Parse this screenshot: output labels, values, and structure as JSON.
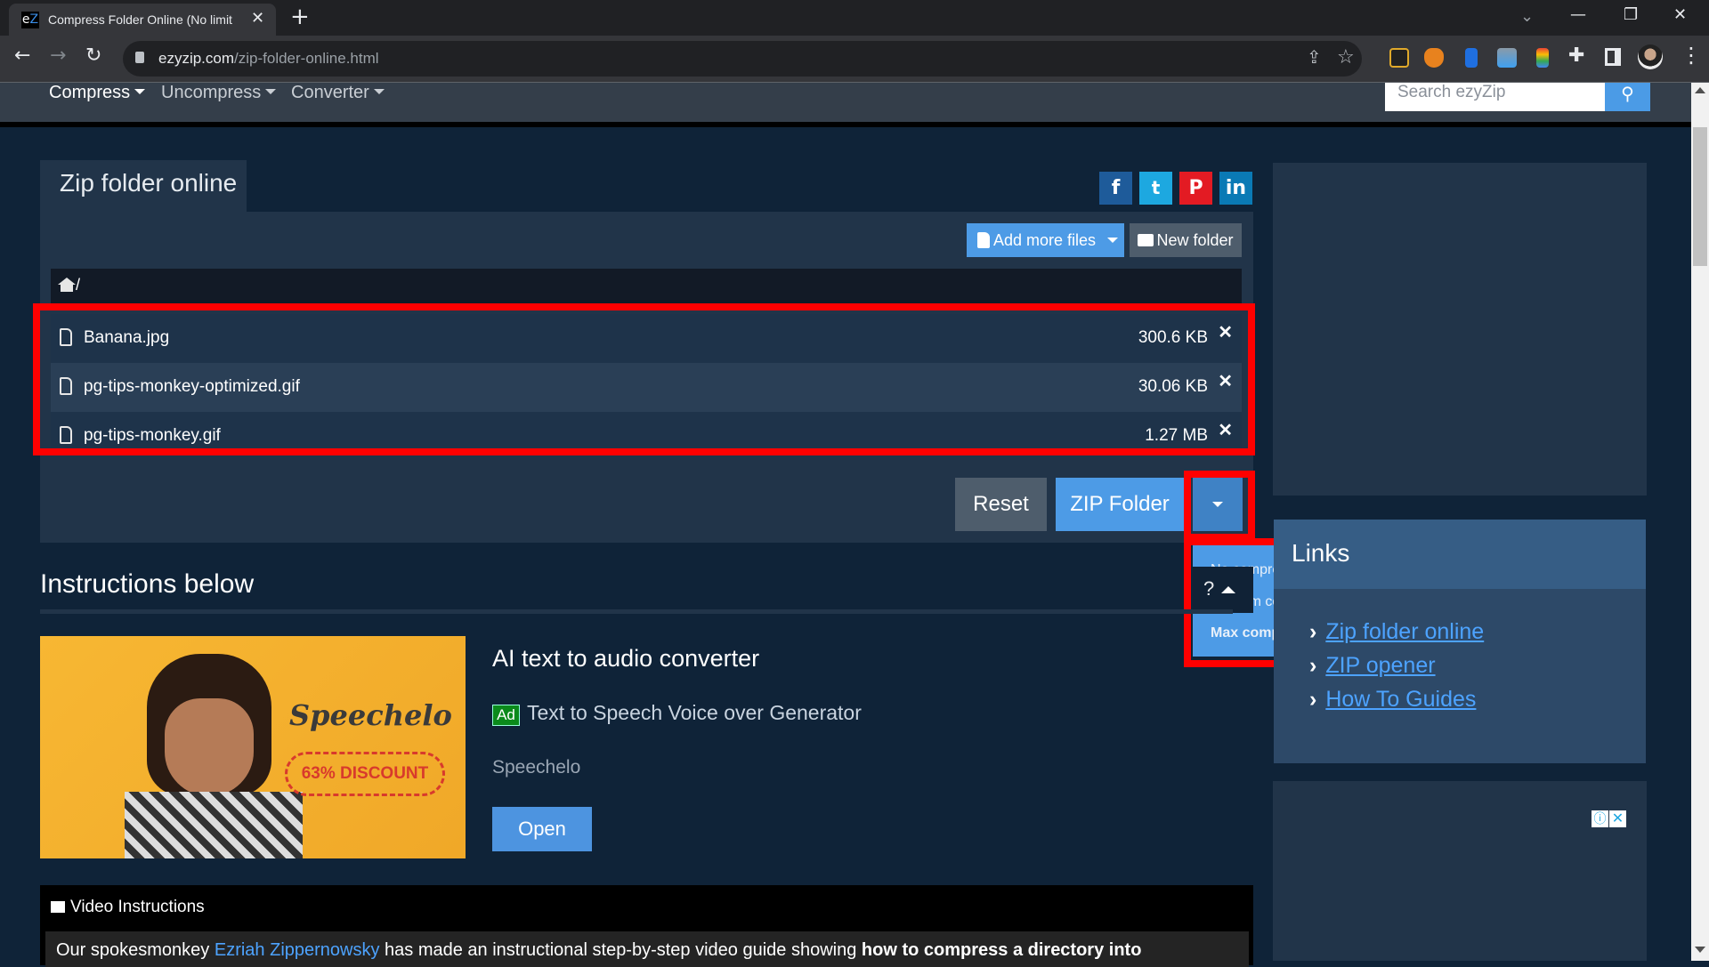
{
  "browser": {
    "tab_title": "Compress Folder Online (No limit",
    "favicon_text_e": "e",
    "favicon_text_z": "Z",
    "url_domain": "ezyzip.com",
    "url_path": "/zip-folder-online.html",
    "new_tab_label": "+",
    "tab_close": "✕",
    "back": "←",
    "forward": "→",
    "reload": "↻",
    "win_chevron": "⌄",
    "win_minimize": "—",
    "win_restore": "❐",
    "win_close": "✕",
    "share": "⇪",
    "star": "☆",
    "menu": "⋮"
  },
  "nav": {
    "items": [
      {
        "label": "Compress",
        "active": true
      },
      {
        "label": "Uncompress"
      },
      {
        "label": "Converter"
      }
    ],
    "search_placeholder": "Search ezyZip",
    "search_icon": "⚲"
  },
  "card": {
    "tab_title": "Zip folder online",
    "social": [
      {
        "name": "facebook",
        "glyph": "f",
        "color": "#1e5b9a"
      },
      {
        "name": "twitter",
        "glyph": "🐦",
        "color": "#1da8e0"
      },
      {
        "name": "pinterest",
        "glyph": "℗",
        "color": "#e31b23"
      },
      {
        "name": "linkedin",
        "glyph": "in",
        "color": "#0a7ab5"
      }
    ],
    "add_files_label": "Add more files",
    "new_folder_label": "New folder",
    "path": "/",
    "files": [
      {
        "name": "Banana.jpg",
        "size": "300.6 KB"
      },
      {
        "name": "pg-tips-monkey-optimized.gif",
        "size": "30.06 KB"
      },
      {
        "name": "pg-tips-monkey.gif",
        "size": "1.27 MB"
      }
    ],
    "remove_glyph": "✕",
    "reset_label": "Reset",
    "zip_label": "ZIP Folder"
  },
  "compression_menu": {
    "options": [
      {
        "label": "No compression (fastest)"
      },
      {
        "label": "Medium compression"
      },
      {
        "label": "Max compression (slowest)",
        "selected": true
      }
    ],
    "tooltip_label": "?"
  },
  "instructions": {
    "heading": "Instructions below",
    "ad": {
      "brand": "Speechelo",
      "discount": "63% DISCOUNT",
      "title": "AI text to audio converter",
      "badge": "Ad",
      "subtitle": "Text to Speech Voice over Generator",
      "sponsor": "Speechelo",
      "button": "Open"
    },
    "video": {
      "heading": "Video Instructions",
      "body_prefix": "Our spokesmonkey ",
      "body_link": "Ezriah Zippernowsky",
      "body_suffix": " has made an instructional step-by-step video guide showing ",
      "body_bold": "how to compress a directory into"
    }
  },
  "sidebar": {
    "links_heading": "Links",
    "links": [
      {
        "label": "Zip folder online"
      },
      {
        "label": "ZIP opener"
      },
      {
        "label": "How To Guides"
      }
    ],
    "ad_info": "ⓘ",
    "ad_close": "✕"
  }
}
